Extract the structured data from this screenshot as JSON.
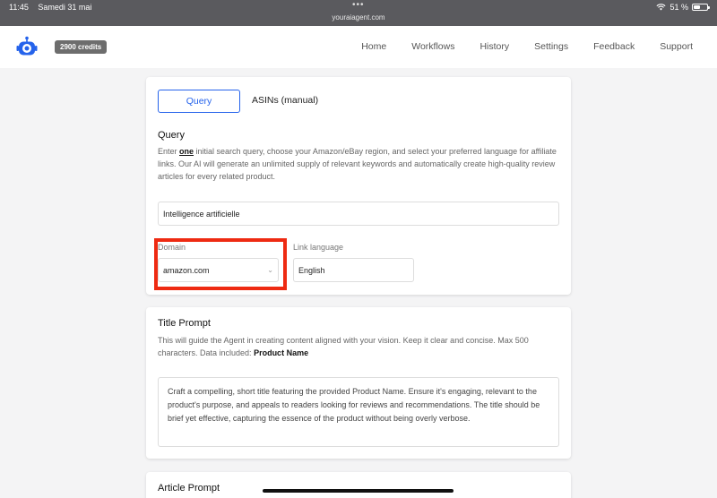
{
  "status_bar": {
    "time": "11:45",
    "date": "Samedi 31 mai",
    "url": "youraiagent.com",
    "battery": "51 %",
    "battery_level": 0.51
  },
  "nav": {
    "credits": "2900 credits",
    "links": [
      "Home",
      "Workflows",
      "History",
      "Settings",
      "Feedback",
      "Support"
    ]
  },
  "query_card": {
    "tabs": [
      "Query",
      "ASINs (manual)"
    ],
    "active_tab": "Query",
    "heading": "Query",
    "desc_pre": "Enter ",
    "desc_em": "one",
    "desc_post": " initial search query, choose your Amazon/eBay region, and select your preferred language for affiliate links. Our AI will generate an unlimited supply of relevant keywords and automatically create high-quality review articles for every related product.",
    "query_value": "Intelligence artificielle",
    "domain_label": "Domain",
    "domain_value": "amazon.com",
    "language_label": "Link language",
    "language_value": "English"
  },
  "title_card": {
    "heading": "Title Prompt",
    "desc": "This will guide the Agent in creating content aligned with your vision. Keep it clear and concise. Max 500 characters. Data included: ",
    "desc_bold": "Product Name",
    "prompt_text": "Craft a compelling, short title featuring the provided Product Name. Ensure it's engaging, relevant to the product's purpose, and appeals to readers looking for reviews and recommendations. The title should be brief yet effective, capturing the essence of the product without being overly verbose."
  },
  "article_card": {
    "heading": "Article Prompt"
  },
  "colors": {
    "accent": "#2563eb",
    "highlight": "#ee2a12"
  }
}
